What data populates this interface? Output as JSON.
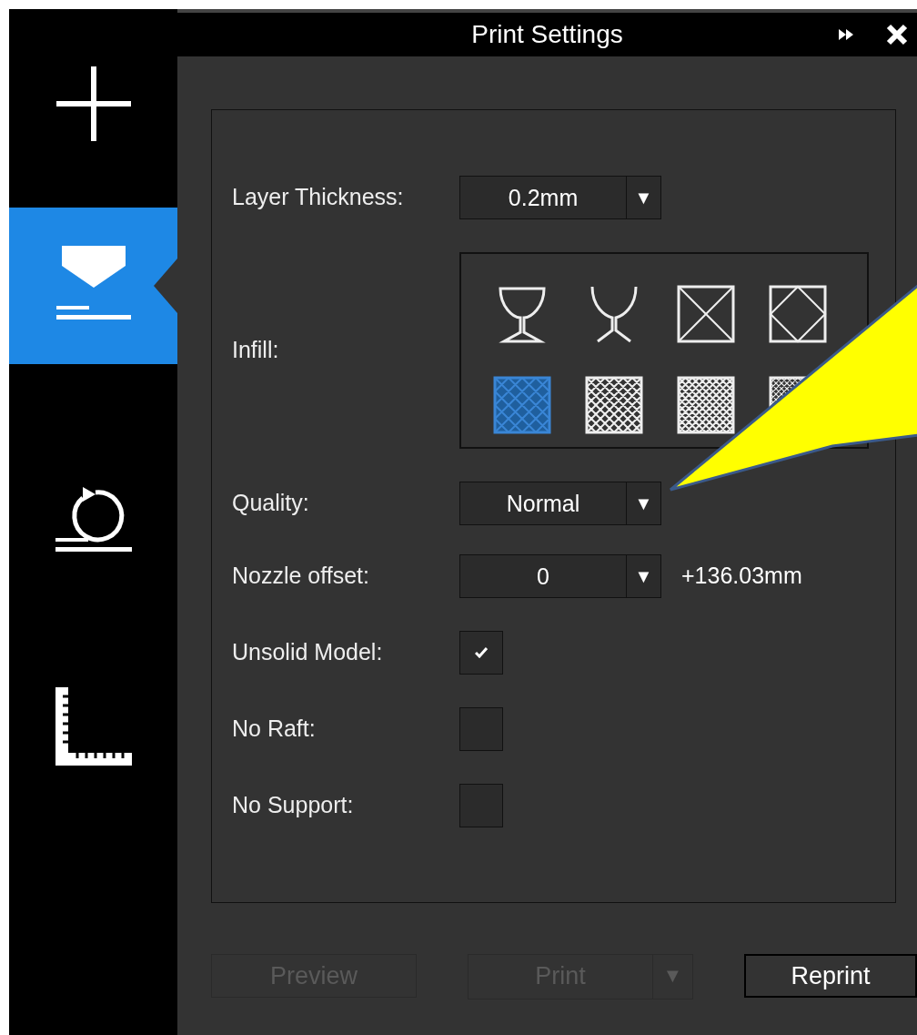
{
  "title": "Print Settings",
  "sidebar": [
    {
      "kind": "add",
      "selected": false
    },
    {
      "kind": "print",
      "selected": true
    },
    {
      "kind": "reprint",
      "selected": false
    },
    {
      "kind": "measure",
      "selected": false
    }
  ],
  "settings": [
    {
      "kind": "dropdown",
      "label": "Layer Thickness:",
      "value": "0.2mm",
      "arrow": "▼"
    },
    {
      "kind": "infill",
      "label": "Infill:",
      "patterns": [
        {
          "kind": "cup",
          "selected": false
        },
        {
          "kind": "open-cup",
          "selected": false
        },
        {
          "kind": "cross",
          "selected": false
        },
        {
          "kind": "diamond",
          "selected": false
        },
        {
          "kind": "mesh-4",
          "selected": true
        },
        {
          "kind": "mesh-6",
          "selected": false
        },
        {
          "kind": "mesh-8",
          "selected": false
        },
        {
          "kind": "mesh-10",
          "selected": false
        }
      ]
    },
    {
      "kind": "dropdown",
      "label": "Quality:",
      "value": "Normal",
      "arrow": "▼"
    },
    {
      "kind": "dropdown",
      "label": "Nozzle offset:",
      "value": "0",
      "arrow": "▼",
      "note": "+136.03mm"
    },
    {
      "kind": "checkbox",
      "label": "Unsolid Model:",
      "checked": true
    },
    {
      "kind": "checkbox",
      "label": "No Raft:",
      "checked": false
    },
    {
      "kind": "checkbox",
      "label": "No Support:",
      "checked": false
    }
  ],
  "buttons": [
    {
      "label": "Preview",
      "disabled": true
    },
    {
      "label": "Print",
      "disabled": true,
      "arrow": "▼"
    },
    {
      "label": "Reprint",
      "disabled": false
    }
  ],
  "callout": {
    "kind": "arrow"
  }
}
